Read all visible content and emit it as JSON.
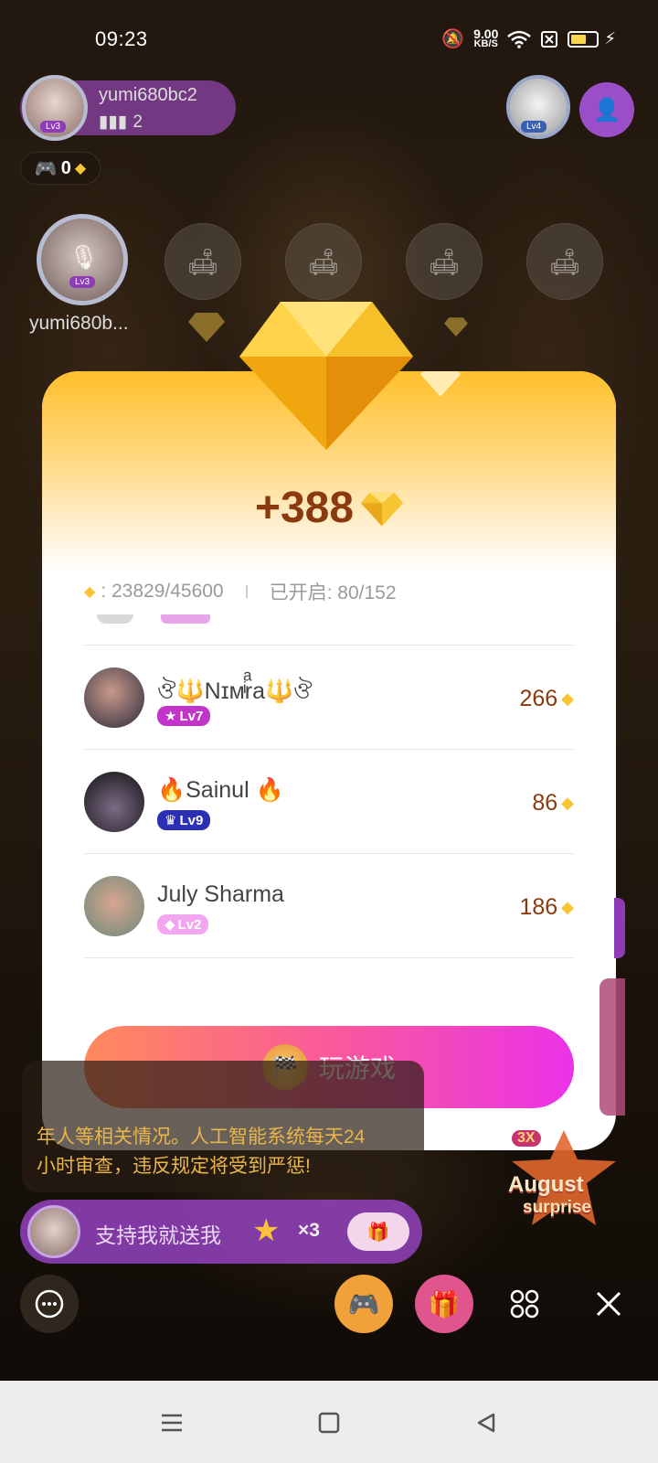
{
  "status_bar": {
    "time": "09:23",
    "speed_value": "9.00",
    "speed_unit": "KB/S",
    "battery_level": 0.6
  },
  "host": {
    "name": "yumi680bc2",
    "fans": "2",
    "level": "Lv3",
    "game_count": "0"
  },
  "top_right": {
    "level": "Lv4"
  },
  "seats": {
    "main_name": "yumi680b...",
    "main_level": "Lv3"
  },
  "popup": {
    "reward": "+388",
    "progress_label": ": 23829/45600",
    "opened_label": "已开启: 80/152",
    "rows": [
      {
        "name": "ঔ🔱Nɪᴍͥrͣa🔱ঔ",
        "level": "Lv7",
        "amount": "266",
        "level_color": "#c235c9"
      },
      {
        "name": "🔥Sainul 🔥",
        "level": "Lv9",
        "amount": "86",
        "level_color": "#2b2fb3"
      },
      {
        "name": "July Sharma",
        "level": "Lv2",
        "amount": "186",
        "level_color": "#f2a6f0"
      }
    ],
    "play_button": "玩游戏"
  },
  "notice": {
    "line1": "年人等相关情况。人工智能系统每天24",
    "line2": "小时审查，违反规定将受到严惩!"
  },
  "promo": {
    "text": "支持我就送我",
    "multiplier": "×3"
  },
  "august": {
    "multiplier": "3X",
    "title": "August",
    "subtitle": "surprise"
  },
  "colors": {
    "accent_purple": "#9a4fc9",
    "gem_gold": "#f7c531",
    "amount_brown": "#8a3a0f"
  }
}
